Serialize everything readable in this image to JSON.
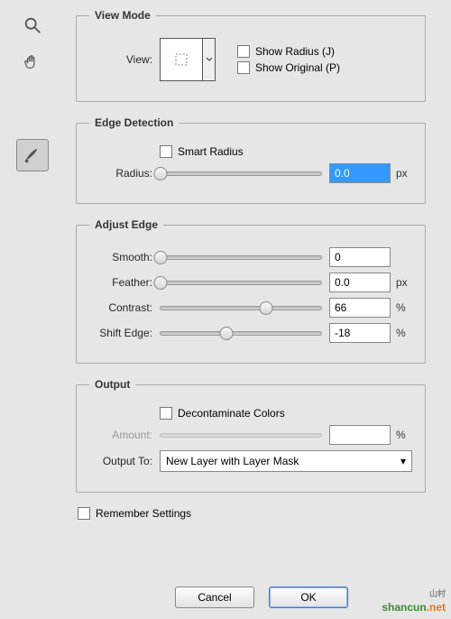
{
  "toolbar": {
    "zoom_icon": "zoom",
    "hand_icon": "hand",
    "brush_icon": "brush"
  },
  "view_mode": {
    "legend": "View Mode",
    "view_label": "View:",
    "show_radius": "Show Radius (J)",
    "show_original": "Show Original (P)"
  },
  "edge_detection": {
    "legend": "Edge Detection",
    "smart_radius": "Smart Radius",
    "radius_label": "Radius:",
    "radius_value": "0.0",
    "radius_unit": "px"
  },
  "adjust_edge": {
    "legend": "Adjust Edge",
    "smooth_label": "Smooth:",
    "smooth_value": "0",
    "feather_label": "Feather:",
    "feather_value": "0.0",
    "feather_unit": "px",
    "contrast_label": "Contrast:",
    "contrast_value": "66",
    "contrast_unit": "%",
    "shift_label": "Shift Edge:",
    "shift_value": "-18",
    "shift_unit": "%"
  },
  "output": {
    "legend": "Output",
    "decontaminate": "Decontaminate Colors",
    "amount_label": "Amount:",
    "amount_value": "",
    "amount_unit": "%",
    "output_to_label": "Output To:",
    "output_to_value": "New Layer with Layer Mask"
  },
  "remember": "Remember Settings",
  "buttons": {
    "cancel": "Cancel",
    "ok": "OK"
  },
  "watermark": {
    "brand": "shancun",
    "suffix": ".net",
    "tag": "山村"
  }
}
